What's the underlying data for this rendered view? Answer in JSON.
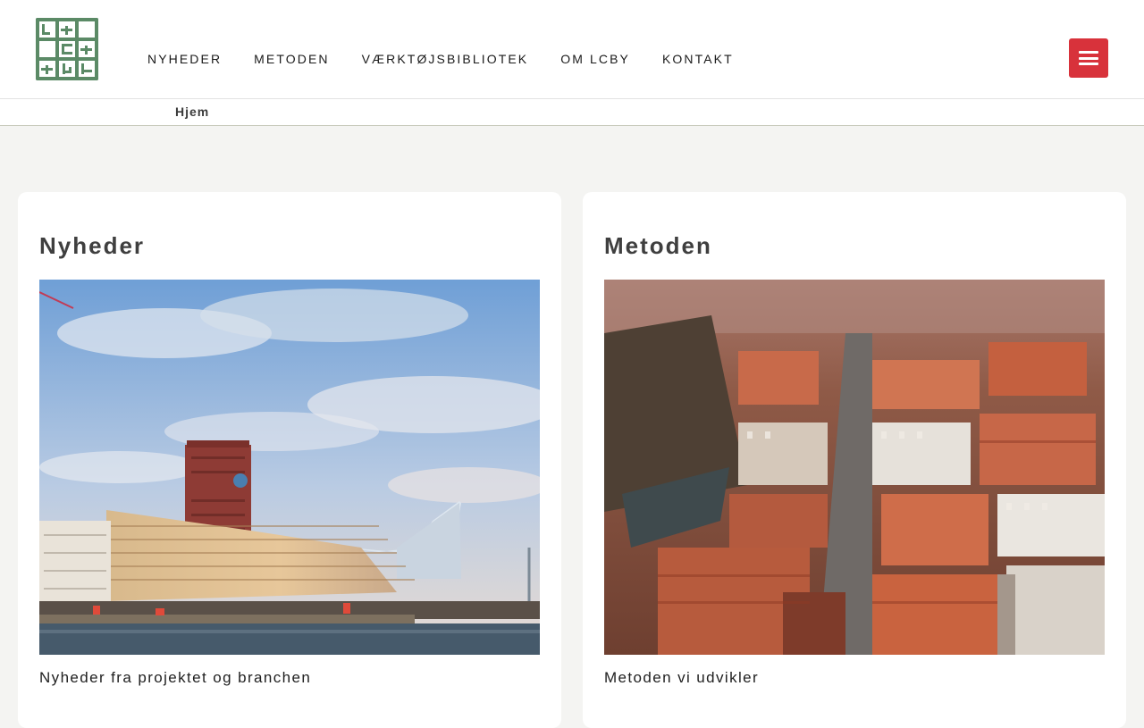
{
  "logo": {
    "text": "LC by",
    "alt": "LCBY logo",
    "color": "#5b8a66"
  },
  "nav": {
    "items": [
      {
        "label": "NYHEDER"
      },
      {
        "label": "METODEN"
      },
      {
        "label": "VÆRKTØJSBIBLIOTEK"
      },
      {
        "label": "OM LCBY"
      },
      {
        "label": "KONTAKT"
      }
    ]
  },
  "menu_button": {
    "icon": "hamburger-icon",
    "color": "#d8323b"
  },
  "breadcrumb": {
    "label": "Hjem"
  },
  "cards": [
    {
      "title": "Nyheder",
      "description": "Nyheder fra projektet og branchen",
      "image": "waterfront-buildings-photo"
    },
    {
      "title": "Metoden",
      "description": "Metoden vi udvikler",
      "image": "aerial-old-town-photo"
    }
  ]
}
